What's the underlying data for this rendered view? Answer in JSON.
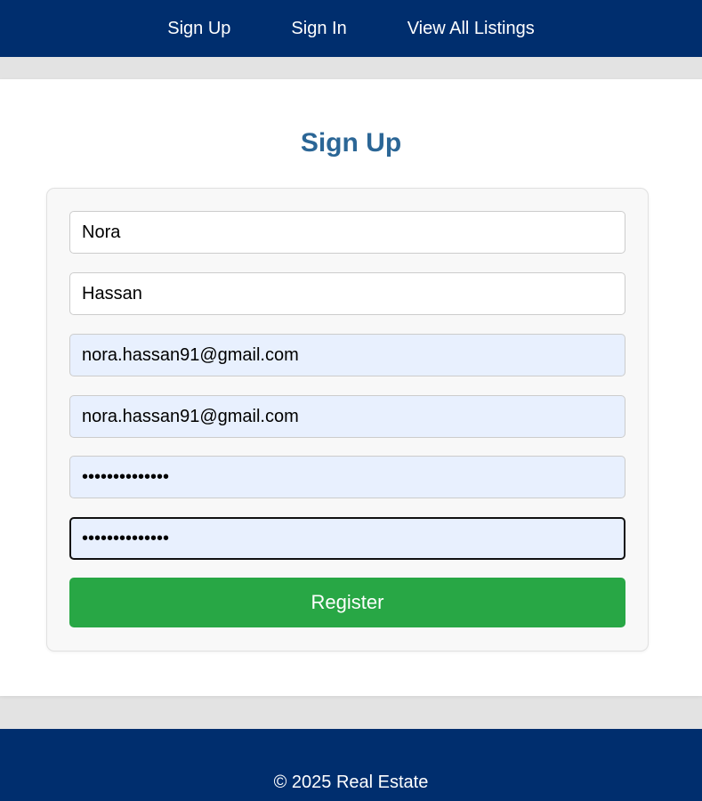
{
  "nav": {
    "links": [
      {
        "label": "Sign Up"
      },
      {
        "label": "Sign In"
      },
      {
        "label": "View All Listings"
      }
    ]
  },
  "page": {
    "title": "Sign Up"
  },
  "form": {
    "first_name": "Nora",
    "last_name": "Hassan",
    "email": "nora.hassan91@gmail.com",
    "confirm_email": "nora.hassan91@gmail.com",
    "password": "••••••••••••••",
    "confirm_password": "••••••••••••••",
    "register_label": "Register"
  },
  "footer": {
    "text": "© 2025 Real Estate"
  },
  "colors": {
    "navbar": "#002e6e",
    "title": "#2b6696",
    "register_button": "#28a745",
    "autofill": "#e8f0fe"
  }
}
